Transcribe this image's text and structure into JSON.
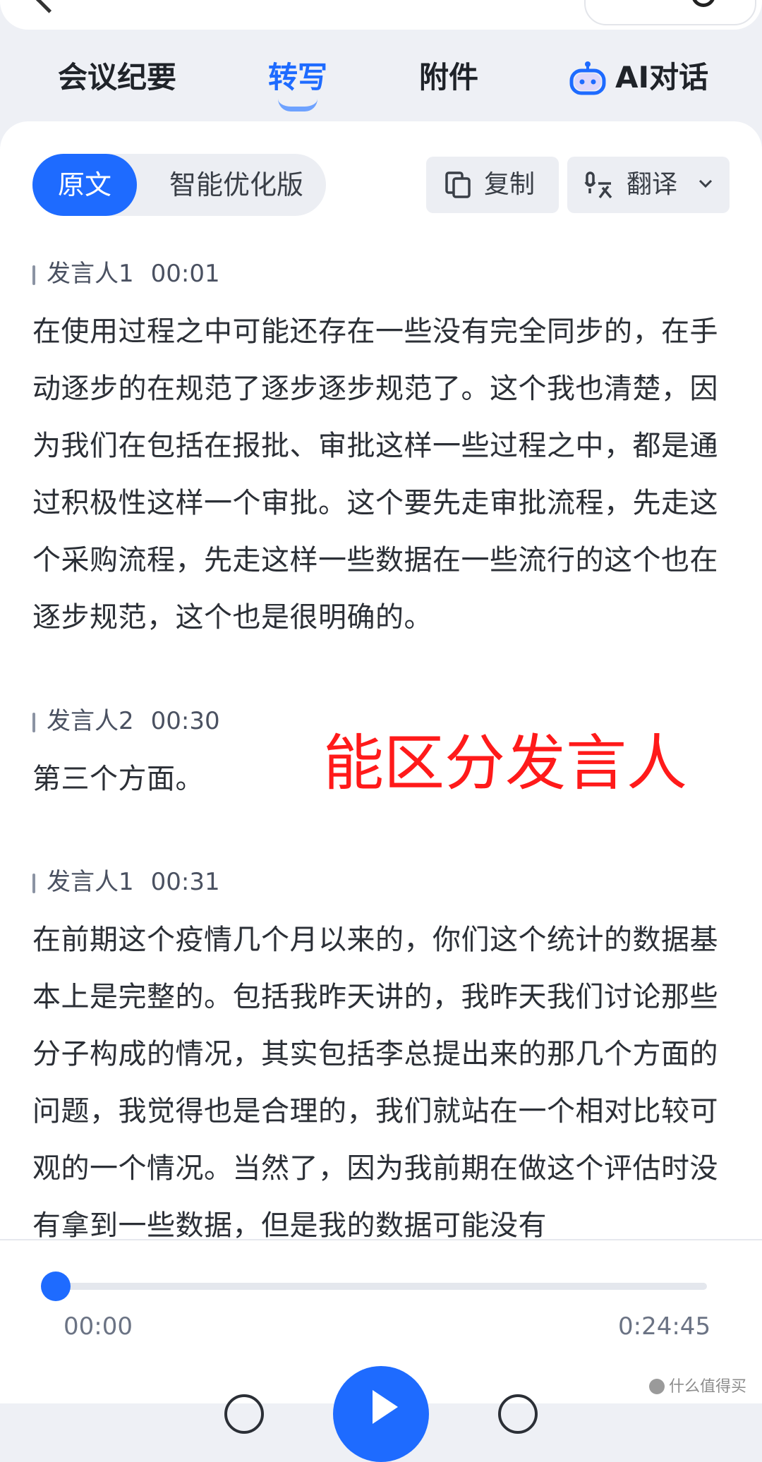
{
  "tabs": [
    {
      "label": "会议纪要"
    },
    {
      "label": "转写"
    },
    {
      "label": "附件"
    },
    {
      "label": "AI对话"
    }
  ],
  "toolbar": {
    "mode_original": "原文",
    "mode_optimized": "智能优化版",
    "copy_label": "复制",
    "translate_label": "翻译"
  },
  "transcript": [
    {
      "speaker": "发言人1",
      "time": "00:01",
      "text": "在使用过程之中可能还存在一些没有完全同步的，在手动逐步的在规范了逐步逐步规范了。这个我也清楚，因为我们在包括在报批、审批这样一些过程之中，都是通过积极性这样一个审批。这个要先走审批流程，先走这个采购流程，先走这样一些数据在一些流行的这个也在逐步规范，这个也是很明确的。"
    },
    {
      "speaker": "发言人2",
      "time": "00:30",
      "text": "第三个方面。"
    },
    {
      "speaker": "发言人1",
      "time": "00:31",
      "text": "在前期这个疫情几个月以来的，你们这个统计的数据基本上是完整的。包括我昨天讲的，我昨天我们讨论那些分子构成的情况，其实包括李总提出来的那几个方面的问题，我觉得也是合理的，我们就站在一个相对比较可观的一个情况。当然了，因为我前期在做这个评估时没有拿到一些数据，但是我的数据可能没有"
    }
  ],
  "annotation": "能区分发言人",
  "player": {
    "current_time": "00:00",
    "total_time": "0:24:45",
    "progress": 0
  },
  "watermark": "什么值得买",
  "colors": {
    "accent": "#1e6bff",
    "annotation": "#ff1a1a"
  }
}
